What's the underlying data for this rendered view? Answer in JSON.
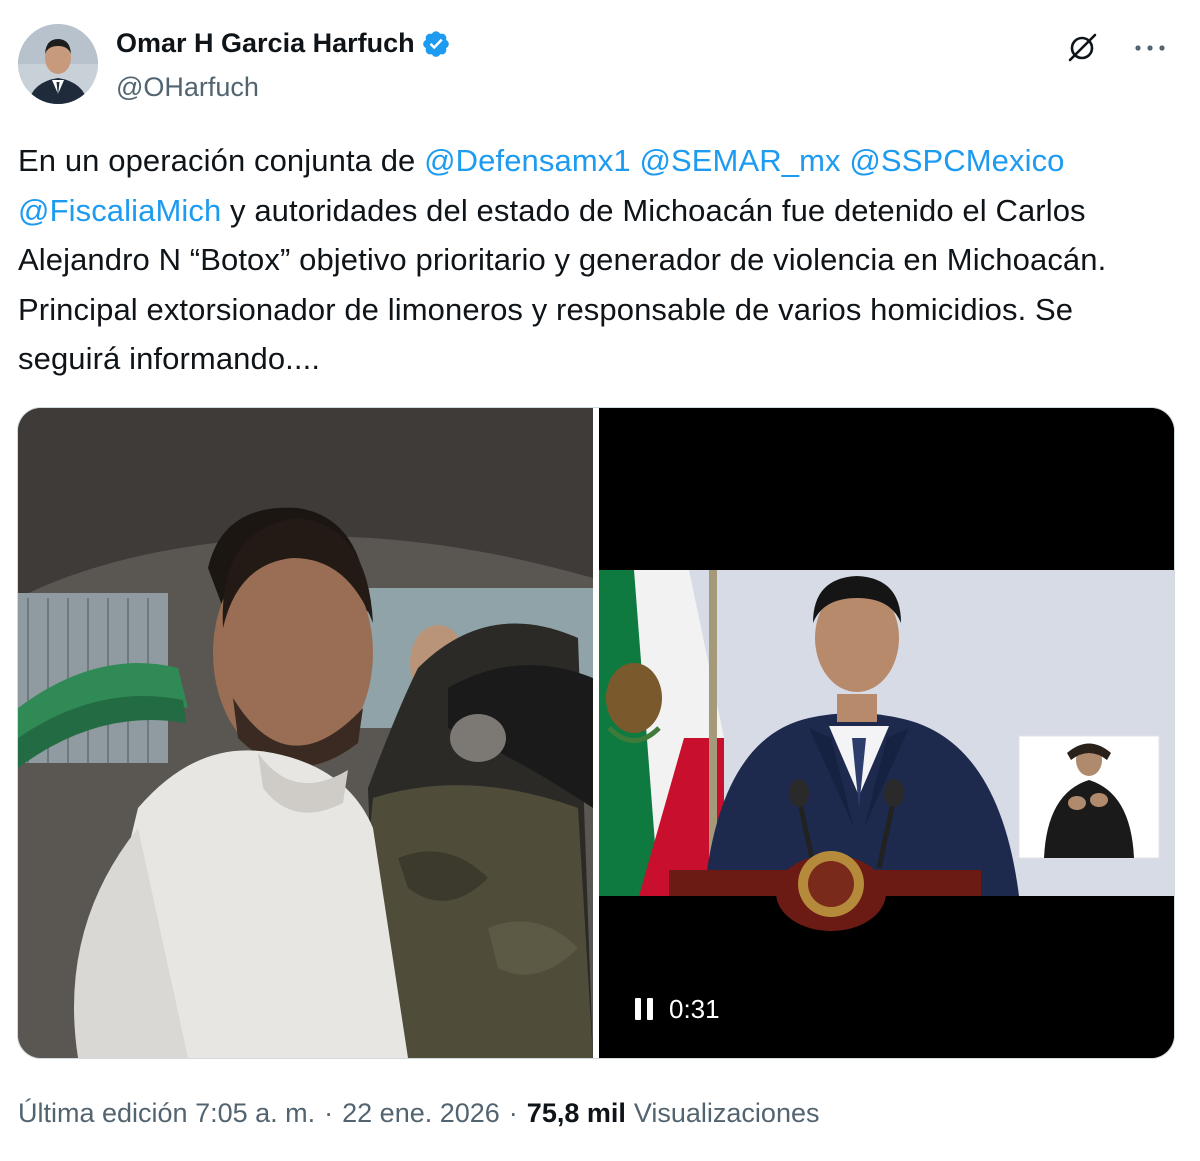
{
  "author": {
    "name": "Omar H Garcia Harfuch",
    "handle": "@OHarfuch",
    "verified": true,
    "verified_color": "#1d9bf0"
  },
  "icons": {
    "grok": "grok-slash-icon",
    "more": "more-dots-icon",
    "verified": "verified-badge-icon",
    "pause": "pause-icon"
  },
  "tweet": {
    "parts": [
      {
        "text": "En un operación conjunta de ",
        "type": "text"
      },
      {
        "text": "@Defensamx1",
        "type": "mention"
      },
      {
        "text": " ",
        "type": "text"
      },
      {
        "text": "@SEMAR_mx",
        "type": "mention"
      },
      {
        "text": " ",
        "type": "text"
      },
      {
        "text": "@SSPCMexico",
        "type": "mention"
      },
      {
        "text": " ",
        "type": "text"
      },
      {
        "text": "@FiscaliaMich",
        "type": "mention"
      },
      {
        "text": " y autoridades del estado de Michoacán fue detenido el Carlos Alejandro N “Botox” objetivo prioritario y generador de violencia en Michoacán. Principal extorsionador de limoneros y responsable de varios homicidios. Se seguirá informando....",
        "type": "text"
      }
    ]
  },
  "media": {
    "video_time": "0:31"
  },
  "footer": {
    "edited": "Última edición 7:05 a. m.",
    "separator": "·",
    "date": "22 ene. 2026",
    "views_count": "75,8 mil",
    "views_label": "Visualizaciones"
  },
  "colors": {
    "mention": "#1d9bf0",
    "secondary_text": "#536471",
    "primary_text": "#0f1419"
  }
}
